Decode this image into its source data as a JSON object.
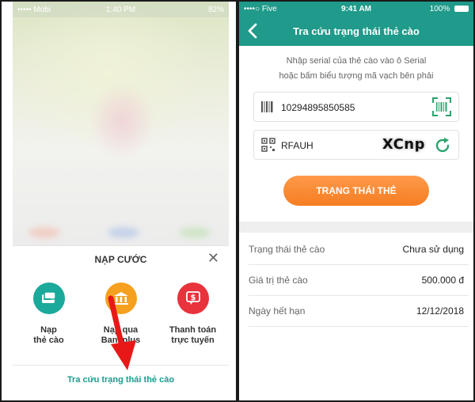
{
  "left": {
    "status": {
      "carrier": "••••• Mobi",
      "time": "1:40 PM",
      "battery": "82%"
    },
    "sheet": {
      "title": "NẠP CƯỚC",
      "options": [
        {
          "label_line1": "Nạp",
          "label_line2": "thẻ cào",
          "color": "#1aa99a",
          "icon": "card-icon"
        },
        {
          "label_line1": "Nạp qua",
          "label_line2": "Bankplus",
          "color": "#f5a11f",
          "icon": "bank-icon"
        },
        {
          "label_line1": "Thanh toán",
          "label_line2": "trực tuyến",
          "color": "#e8333d",
          "icon": "payment-icon"
        }
      ],
      "link": "Tra cứu trạng thái thẻ cào"
    }
  },
  "right": {
    "status": {
      "carrier": "••••○ Five",
      "time": "9:41 AM",
      "battery": "100%"
    },
    "nav": {
      "title": "Tra cứu trạng thái thẻ cào"
    },
    "hint_line1": "Nhập serial của thẻ cào vào ô Serial",
    "hint_line2": "hoặc bấm biểu tượng mã vạch bên phải",
    "serial": {
      "value": "10294895850585"
    },
    "captcha": {
      "value": "RFAUH",
      "code": "XCnp"
    },
    "button": "TRẠNG THÁI THẺ",
    "results": [
      {
        "key": "Trạng thái thẻ cào",
        "value": "Chưa sử dụng"
      },
      {
        "key": "Giá trị thẻ cào",
        "value": "500.000 đ"
      },
      {
        "key": "Ngày hết hạn",
        "value": "12/12/2018"
      }
    ],
    "colors": {
      "brand": "#209a8a",
      "accent": "#f57d22"
    }
  }
}
